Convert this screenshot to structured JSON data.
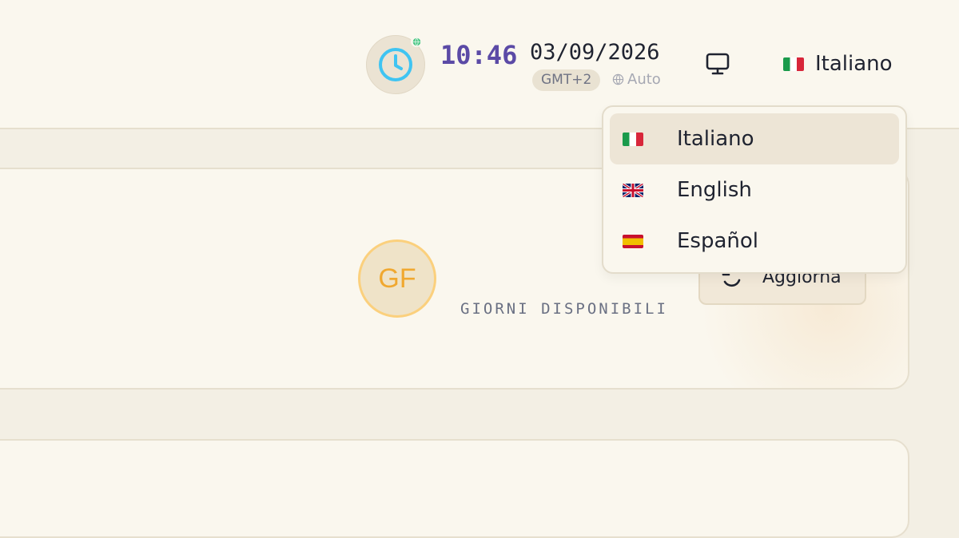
{
  "header": {
    "time": "10:46",
    "date": "03/09/2026",
    "timezone": "GMT+2",
    "timezone_mode": "Auto",
    "language_selected": "Italiano"
  },
  "card": {
    "avatar_initials": "GF",
    "days_label": "GIORNI DISPONIBILI",
    "refresh_label": "Aggiorna"
  },
  "language_menu": {
    "items": [
      {
        "label": "Italiano",
        "flag": "it",
        "active": true
      },
      {
        "label": "English",
        "flag": "gb",
        "active": false
      },
      {
        "label": "Español",
        "flag": "es",
        "active": false
      }
    ]
  },
  "colors": {
    "accent_time": "#5b4aa6",
    "clock_icon": "#3fc4f2",
    "avatar_text": "#f0a830",
    "background": "#f3efe4"
  },
  "icons": [
    "clock-icon",
    "globe-icon",
    "monitor-icon",
    "refresh-icon"
  ]
}
